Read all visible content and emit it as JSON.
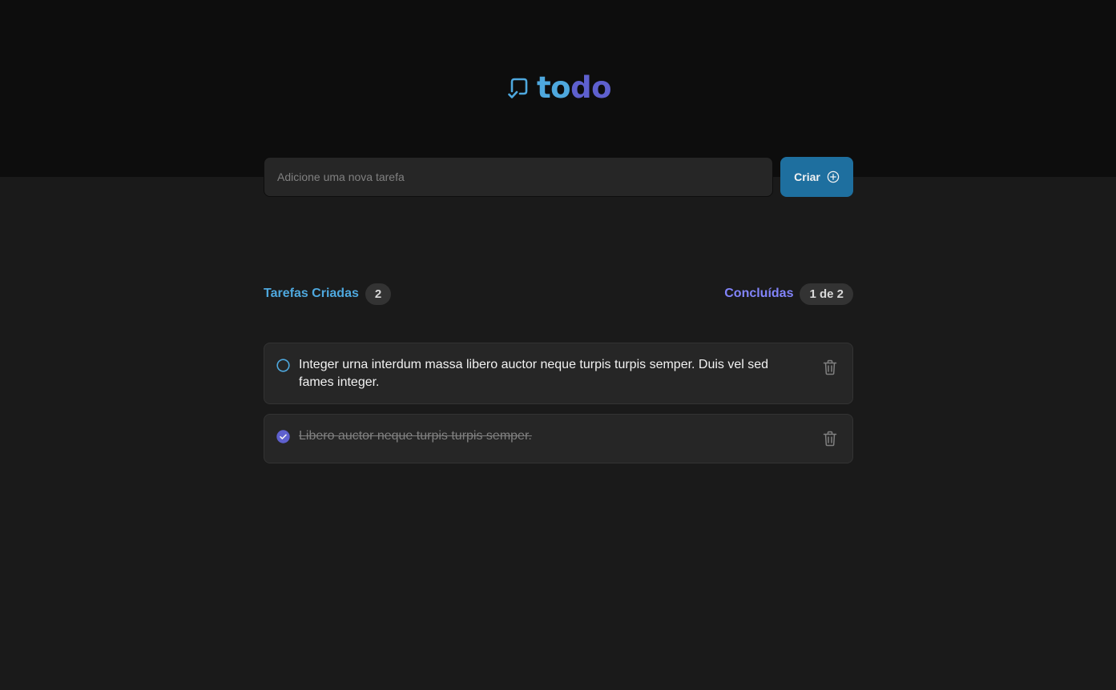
{
  "app": {
    "logo_text_part1": "to",
    "logo_text_part2": "do",
    "logo_icon": "checkbox-rocket-icon"
  },
  "new_task": {
    "placeholder": "Adicione uma nova tarefa",
    "value": "",
    "create_label": "Criar",
    "create_icon": "plus-circle-icon"
  },
  "counters": {
    "created_label": "Tarefas Criadas",
    "created_count": "2",
    "done_label": "Concluídas",
    "done_count": "1 de 2"
  },
  "tasks": [
    {
      "text": "Integer urna interdum massa libero auctor neque turpis turpis semper. Duis vel sed fames integer.",
      "completed": false
    },
    {
      "text": "Libero auctor neque turpis turpis semper.",
      "completed": true
    }
  ],
  "colors": {
    "header_bg": "#0d0d0d",
    "page_bg": "#1a1a1a",
    "card_bg": "#262626",
    "blue": "#4ea8de",
    "blue_dark": "#1e6f9f",
    "purple": "#8284fa",
    "purple_dark": "#5e60ce",
    "muted": "#808080"
  }
}
